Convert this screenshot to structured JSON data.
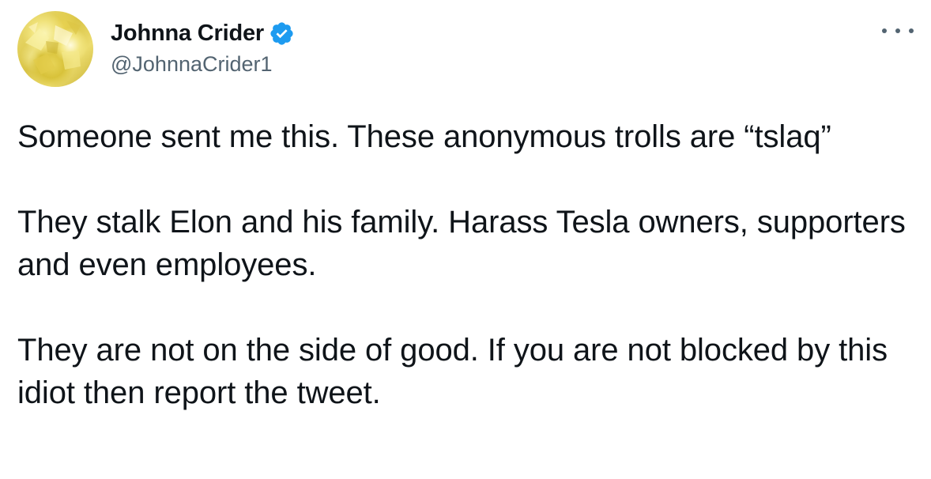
{
  "author": {
    "display_name": "Johnna Crider",
    "handle": "@JohnnaCrider1",
    "verified_icon": "verified-badge-icon",
    "avatar_icon": "avatar-image"
  },
  "menu": {
    "more_icon": "more-options-icon"
  },
  "tweet": {
    "paragraphs": [
      "Someone sent me this. These anonymous trolls are “tslaq”",
      "They stalk Elon and his family. Harass Tesla owners, supporters and even employees.",
      "They are not on the side of good. If you are not blocked by this idiot then report the tweet."
    ]
  },
  "colors": {
    "text_primary": "#0f1419",
    "text_secondary": "#536471",
    "verified_blue": "#1d9bf0"
  }
}
